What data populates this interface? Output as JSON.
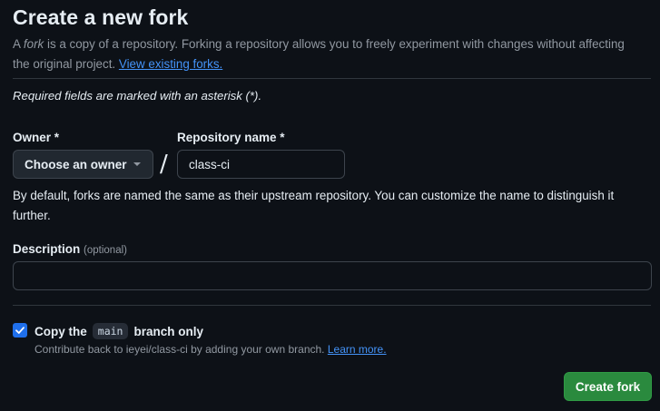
{
  "header": {
    "title": "Create a new fork",
    "desc_prefix": "A ",
    "desc_em": "fork",
    "desc_rest": " is a copy of a repository. Forking a repository allows you to freely experiment with changes without affecting the original project. ",
    "view_forks_link": "View existing forks."
  },
  "form": {
    "required_note": "Required fields are marked with an asterisk (*).",
    "owner_label": "Owner *",
    "owner_button": "Choose an owner",
    "slash": "/",
    "repo_label": "Repository name *",
    "repo_value": "class-ci",
    "naming_hint": "By default, forks are named the same as their upstream repository. You can customize the name to distinguish it further.",
    "description_label": "Description",
    "description_optional": "(optional)",
    "description_value": "",
    "copy_prefix": "Copy the",
    "copy_branch": "main",
    "copy_suffix": "branch only",
    "copy_checked": true,
    "contribute_text": "Contribute back to ieyei/class-ci by adding your own branch. ",
    "learn_more": "Learn more.",
    "create_button": "Create fork"
  },
  "colors": {
    "background": "#0d1117",
    "link": "#4493f8",
    "checkbox": "#1f6feb",
    "primary_button": "#2a8a3e"
  },
  "icons": {
    "owner_dropdown": "triangle-down-icon",
    "checkbox": "check-icon"
  }
}
